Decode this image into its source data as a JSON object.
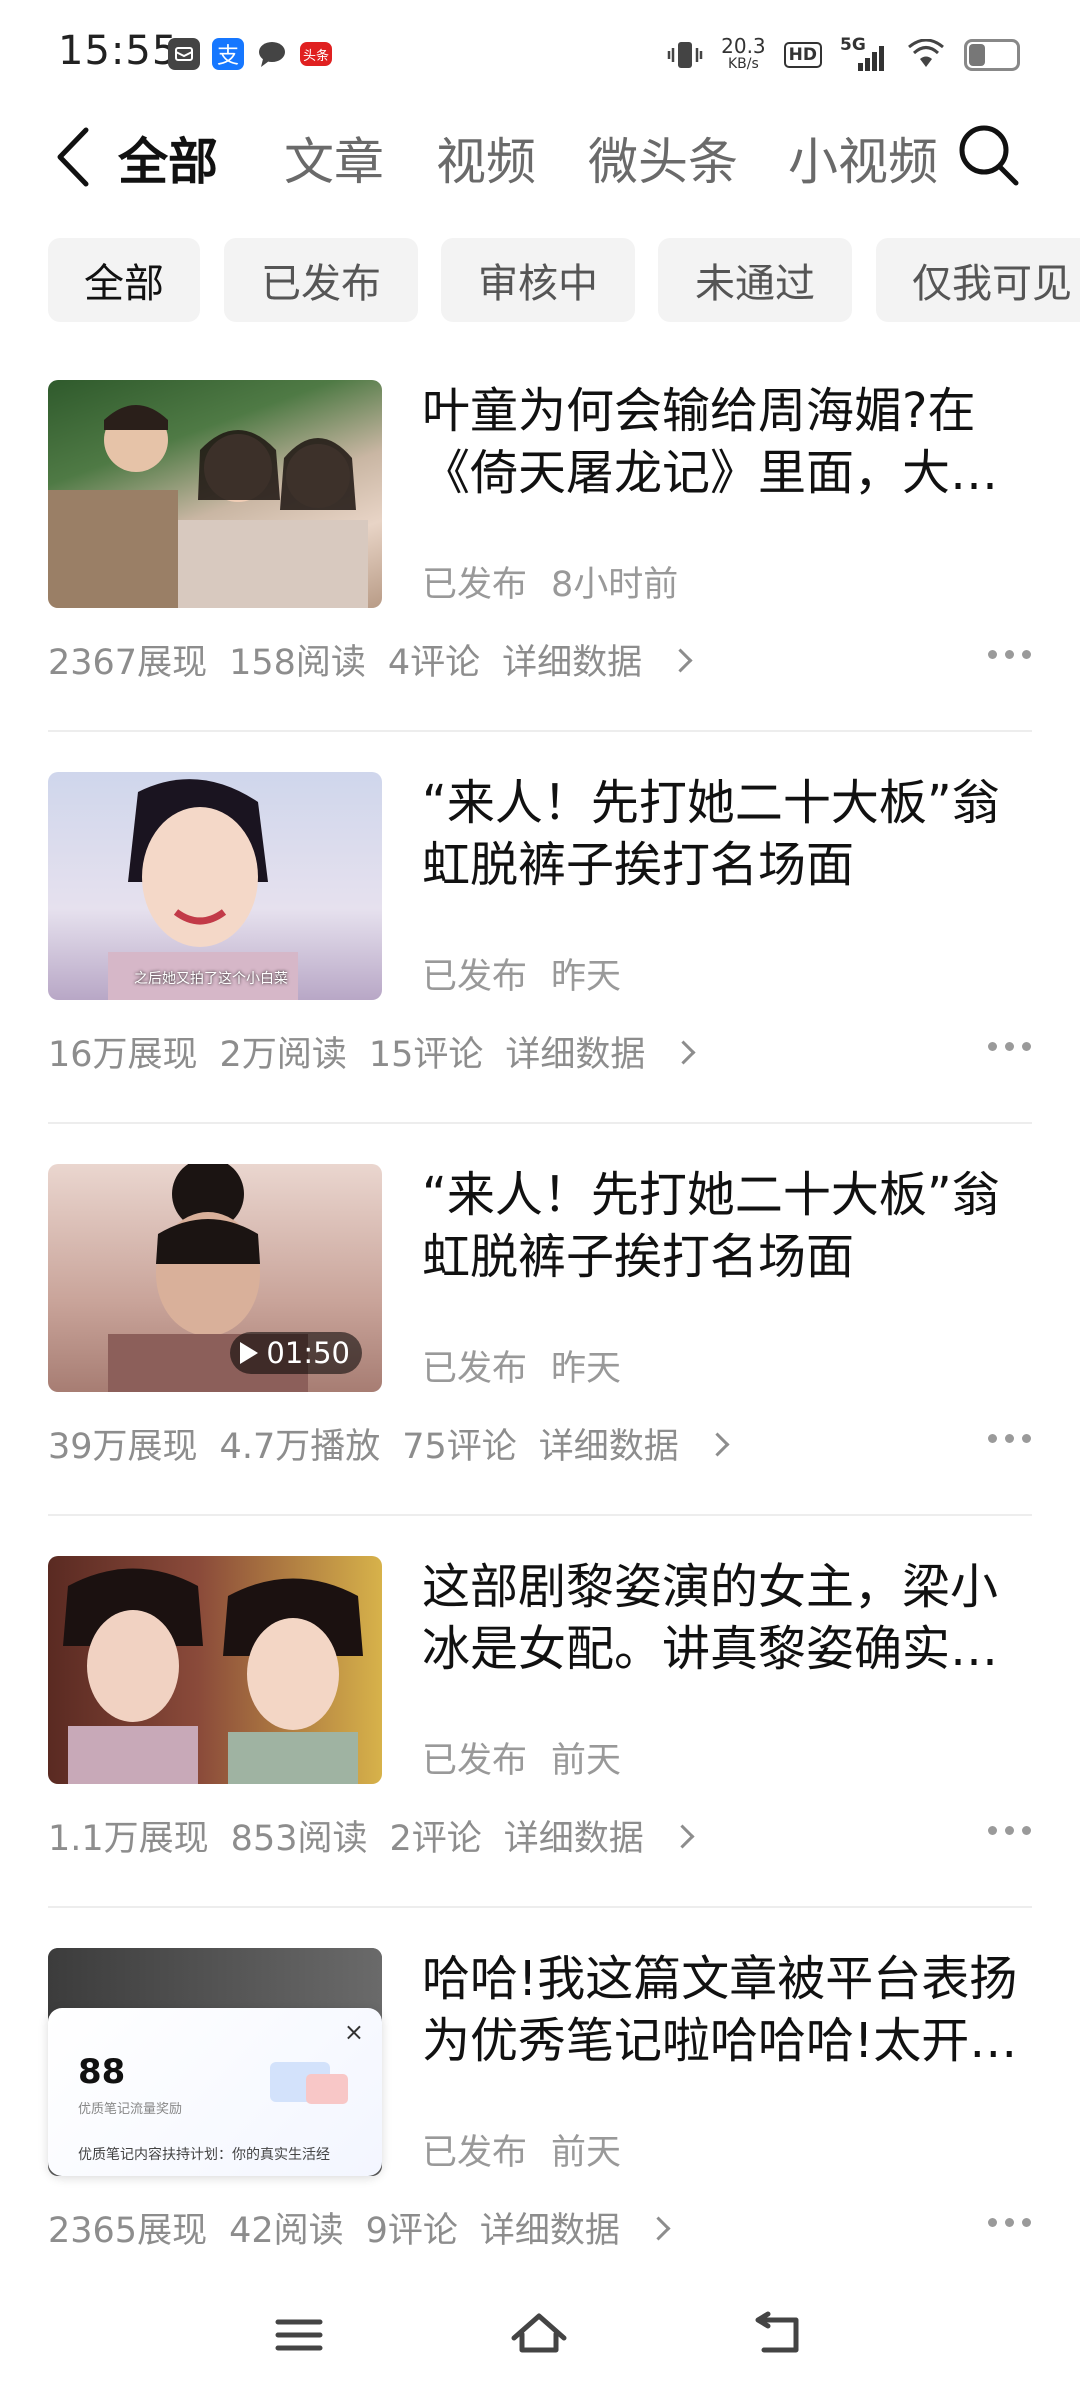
{
  "status_bar": {
    "time": "15:55",
    "net_speed_value": "20.3",
    "net_speed_unit": "KB/s",
    "hd_label": "HD",
    "signal_label": "5G",
    "app_badge_alipay": "支",
    "app_badge_toutiao": "头条",
    "icons": [
      "notification-icon",
      "alipay-icon",
      "message-icon",
      "toutiao-icon",
      "vibrate-icon",
      "wifi-icon",
      "battery-icon"
    ]
  },
  "nav": {
    "tabs": [
      {
        "label": "全部",
        "active": true
      },
      {
        "label": "文章",
        "active": false
      },
      {
        "label": "视频",
        "active": false
      },
      {
        "label": "微头条",
        "active": false
      },
      {
        "label": "小视频",
        "active": false
      }
    ]
  },
  "filters": [
    {
      "label": "全部",
      "active": true
    },
    {
      "label": "已发布",
      "active": false
    },
    {
      "label": "审核中",
      "active": false
    },
    {
      "label": "未通过",
      "active": false
    },
    {
      "label": "仅我可见",
      "active": false
    }
  ],
  "details_label": "详细数据",
  "items": [
    {
      "title": "叶童为何会输给周海媚?在《倚天屠龙记》里面，大家都知道叶童演的赵敏",
      "status": "已发布",
      "time": "8小时前",
      "stats": [
        "2367展现",
        "158阅读",
        "4评论"
      ]
    },
    {
      "title": "“来人！先打她二十大板”翁虹脱裤子挨打名场面",
      "status": "已发布",
      "time": "昨天",
      "stats": [
        "16万展现",
        "2万阅读",
        "15评论"
      ],
      "thumb_caption": "之后她又拍了这个小白菜"
    },
    {
      "title": "“来人！先打她二十大板”翁虹脱裤子挨打名场面",
      "status": "已发布",
      "time": "昨天",
      "stats": [
        "39万展现",
        "4.7万播放",
        "75评论"
      ],
      "duration": "01:50"
    },
    {
      "title": "这部剧黎姿演的女主，梁小冰是女配。讲真黎姿确实很美",
      "status": "已发布",
      "time": "前天",
      "stats": [
        "1.1万展现",
        "853阅读",
        "2评论"
      ]
    },
    {
      "title": "哈哈!我这篇文章被平台表扬为优秀笔记啦哈哈哈!太开心了",
      "status": "已发布",
      "time": "前天",
      "stats": [
        "2365展现",
        "42阅读",
        "9评论"
      ],
      "popup": {
        "number": "88",
        "label": "优质笔记流量奖励",
        "text": "优质笔记内容扶持计划：你的真实生活经"
      }
    }
  ],
  "colors": {
    "text_primary": "#111111",
    "text_secondary": "#999999",
    "chip_bg": "#f3f3f3",
    "divider": "#ededed"
  }
}
